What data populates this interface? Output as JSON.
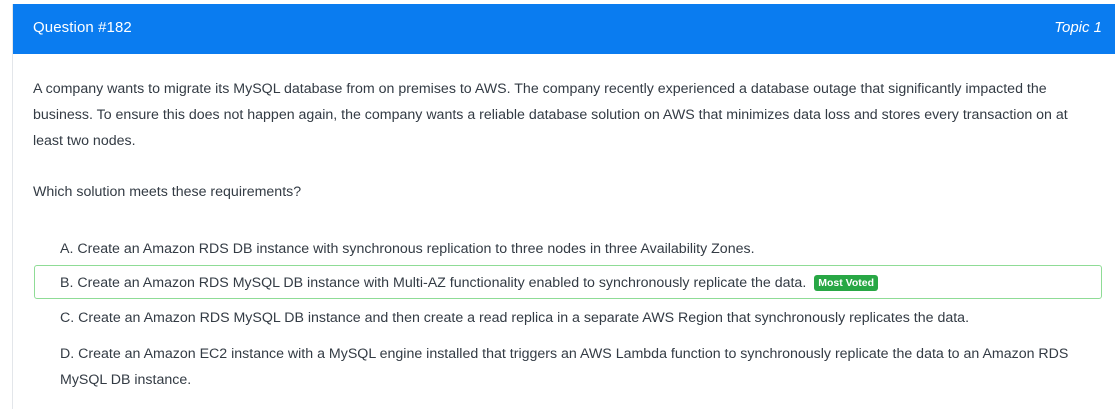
{
  "header": {
    "question_number": "Question #182",
    "topic": "Topic 1",
    "bg_color": "#0a7cf0"
  },
  "question": {
    "text": "A company wants to migrate its MySQL database from on premises to AWS. The company recently experienced a database outage that significantly impacted the business. To ensure this does not happen again, the company wants a reliable database solution on AWS that minimizes data loss and stores every transaction on at least two nodes.",
    "prompt": "Which solution meets these requirements?"
  },
  "choices": [
    {
      "text": "A. Create an Amazon RDS DB instance with synchronous replication to three nodes in three Availability Zones."
    },
    {
      "text": "B. Create an Amazon RDS MySQL DB instance with Multi-AZ functionality enabled to synchronously replicate the data.",
      "badge": "Most Voted"
    },
    {
      "text": "C. Create an Amazon RDS MySQL DB instance and then create a read replica in a separate AWS Region that synchronously replicates the data."
    },
    {
      "text": "D. Create an Amazon EC2 instance with a MySQL engine installed that triggers an AWS Lambda function to synchronously replicate the data to an Amazon RDS MySQL DB instance."
    }
  ],
  "colors": {
    "most_voted_border": "#8fdc96",
    "badge_green": "#28a745"
  }
}
